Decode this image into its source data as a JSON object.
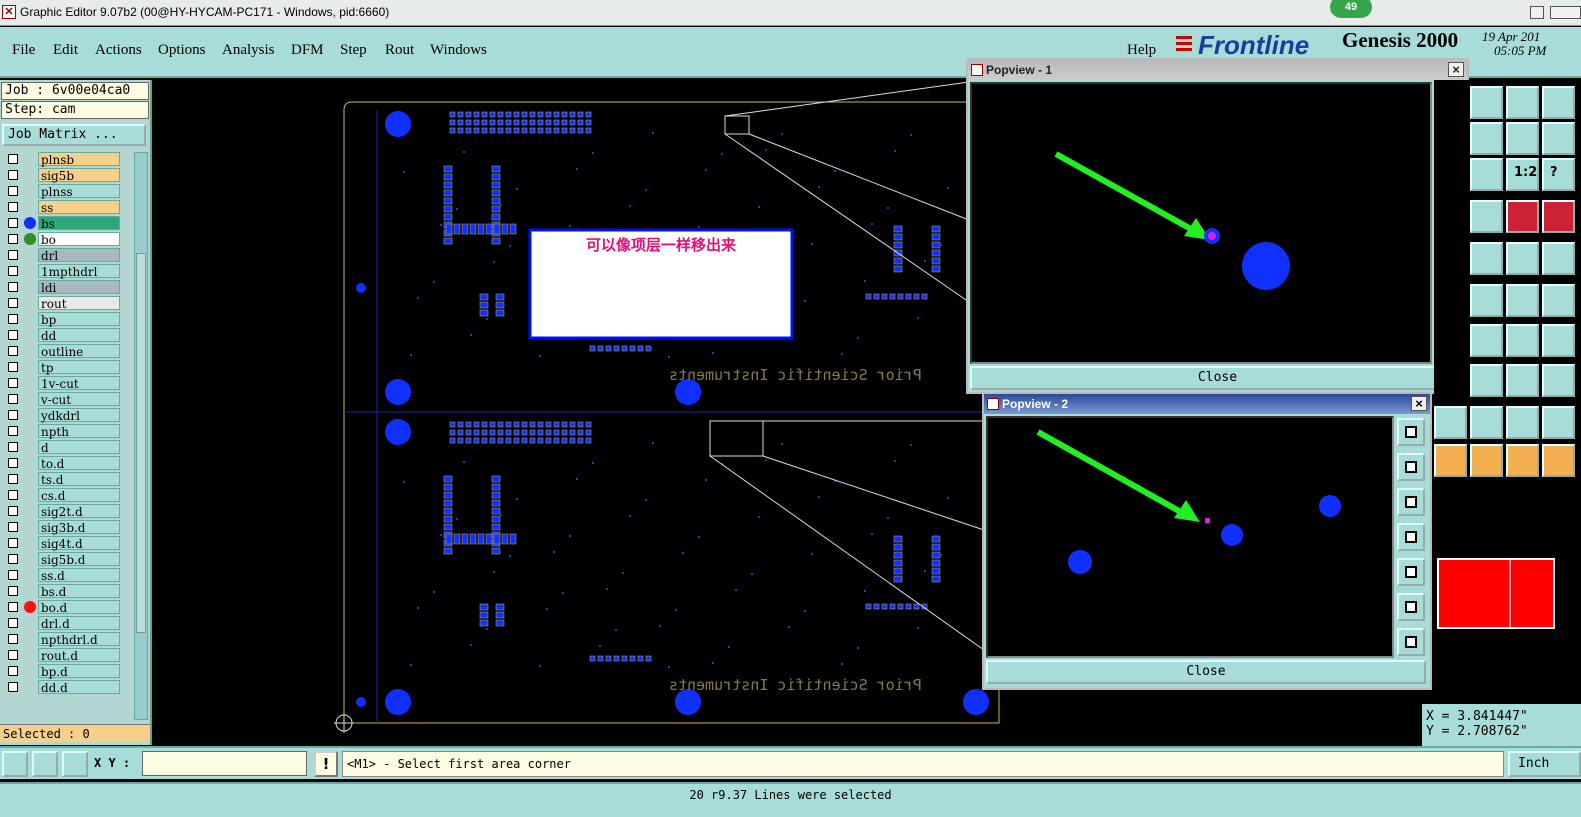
{
  "window": {
    "title": "Graphic Editor 9.07b2 (00@HY-HYCAM-PC171 - Windows, pid:6660)",
    "badge": "49"
  },
  "menu": {
    "items": [
      "File",
      "Edit",
      "Actions",
      "Options",
      "Analysis",
      "DFM",
      "Step",
      "Rout",
      "Windows"
    ],
    "help": "Help"
  },
  "brand": {
    "logo": "Frontline",
    "product": "Genesis 2000",
    "date": "19 Apr 201",
    "time": "05:05 PM"
  },
  "job": {
    "job_label": "Job : 6v00e04ca0",
    "step_label": "Step: cam",
    "matrix_button": "Job Matrix ..."
  },
  "layers": [
    {
      "name": "plnsb",
      "color": "#f6d08a",
      "dot": ""
    },
    {
      "name": "sig5b",
      "color": "#f6d08a",
      "dot": ""
    },
    {
      "name": "plnss",
      "color": "#a8dcd8",
      "dot": ""
    },
    {
      "name": "ss",
      "color": "#f6d08a",
      "dot": ""
    },
    {
      "name": "bs",
      "color": "#2aa87a",
      "dot": "#1030ff"
    },
    {
      "name": "bo",
      "color": "#ffffff",
      "dot": "#2a9020"
    },
    {
      "name": "drl",
      "color": "#a8b8c0",
      "dot": ""
    },
    {
      "name": "1mpthdrl",
      "color": "#a8dcd8",
      "dot": ""
    },
    {
      "name": "ldi",
      "color": "#a8b8c0",
      "dot": ""
    },
    {
      "name": "rout",
      "color": "#e8e8e8",
      "dot": ""
    },
    {
      "name": "bp",
      "color": "#a8dcd8",
      "dot": ""
    },
    {
      "name": "dd",
      "color": "#a8dcd8",
      "dot": ""
    },
    {
      "name": "outline",
      "color": "#a8dcd8",
      "dot": ""
    },
    {
      "name": "tp",
      "color": "#a8dcd8",
      "dot": ""
    },
    {
      "name": "1v-cut",
      "color": "#a8dcd8",
      "dot": ""
    },
    {
      "name": "v-cut",
      "color": "#a8dcd8",
      "dot": ""
    },
    {
      "name": "ydkdrl",
      "color": "#a8dcd8",
      "dot": ""
    },
    {
      "name": "npth",
      "color": "#a8dcd8",
      "dot": ""
    },
    {
      "name": "d",
      "color": "#a8dcd8",
      "dot": ""
    },
    {
      "name": "to.d",
      "color": "#a8dcd8",
      "dot": ""
    },
    {
      "name": "ts.d",
      "color": "#a8dcd8",
      "dot": ""
    },
    {
      "name": "cs.d",
      "color": "#a8dcd8",
      "dot": ""
    },
    {
      "name": "sig2t.d",
      "color": "#a8dcd8",
      "dot": ""
    },
    {
      "name": "sig3b.d",
      "color": "#a8dcd8",
      "dot": ""
    },
    {
      "name": "sig4t.d",
      "color": "#a8dcd8",
      "dot": ""
    },
    {
      "name": "sig5b.d",
      "color": "#a8dcd8",
      "dot": ""
    },
    {
      "name": "ss.d",
      "color": "#a8dcd8",
      "dot": ""
    },
    {
      "name": "bs.d",
      "color": "#a8dcd8",
      "dot": ""
    },
    {
      "name": "bo.d",
      "color": "#a8dcd8",
      "dot": "#ff1010"
    },
    {
      "name": "drl.d",
      "color": "#a8dcd8",
      "dot": ""
    },
    {
      "name": "npthdrl.d",
      "color": "#a8dcd8",
      "dot": ""
    },
    {
      "name": "rout.d",
      "color": "#a8dcd8",
      "dot": ""
    },
    {
      "name": "bp.d",
      "color": "#a8dcd8",
      "dot": ""
    },
    {
      "name": "dd.d",
      "color": "#a8dcd8",
      "dot": ""
    }
  ],
  "selected_label": "Selected : 0",
  "board": {
    "annotation": "可以像项层一样移出来",
    "silkscreen": "Prior Scientific Instruments"
  },
  "popview1": {
    "title": "Popview - 1",
    "close": "Close"
  },
  "popview2": {
    "title": "Popview - 2",
    "close": "Close"
  },
  "coords": {
    "x": "X = 3.841447\"",
    "y": "Y = 2.708762\""
  },
  "bottom": {
    "xy_label": "X Y :",
    "xy_value": "",
    "warn": "!",
    "prompt": "<M1> - Select first area corner",
    "units": "Inch"
  },
  "status": "20 r9.37 Lines were selected",
  "colors": {
    "panel": "#a8dcd8",
    "pad": "#1030ff",
    "arrow": "#22ee22",
    "outline": "#c8b45a"
  }
}
